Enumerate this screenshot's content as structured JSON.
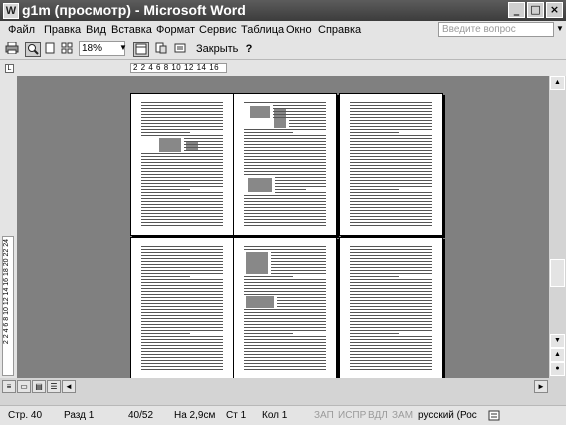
{
  "window": {
    "title": "g1m (просмотр) - Microsoft Word",
    "app_icon": "W",
    "minimize_glyph": "_",
    "maximize_glyph": "□",
    "close_glyph": "×"
  },
  "menu": {
    "items": [
      "Файл",
      "Правка",
      "Вид",
      "Вставка",
      "Формат",
      "Сервис",
      "Таблица",
      "Окно",
      "Справка"
    ],
    "help_placeholder": "Введите вопрос"
  },
  "toolbar": {
    "zoom": "18%",
    "close_label": "Закрыть",
    "help_glyph": "?"
  },
  "ruler": {
    "corner_glyph": "L",
    "horizontal_label": "2 2 4 6 8 10 12 14 16",
    "vertical_label": "2 2 4 6 8 10 12 14 16 18 20 22 24"
  },
  "status": {
    "page": "Стр. 40",
    "section": "Разд 1",
    "page_of": "40/52",
    "position": "На 2,9см",
    "line": "Ст 1",
    "column": "Кол 1",
    "rec": "ЗАП",
    "trk": "ИСПР",
    "ext": "ВДЛ",
    "ovr": "ЗАМ",
    "language": "русский (Рос"
  }
}
